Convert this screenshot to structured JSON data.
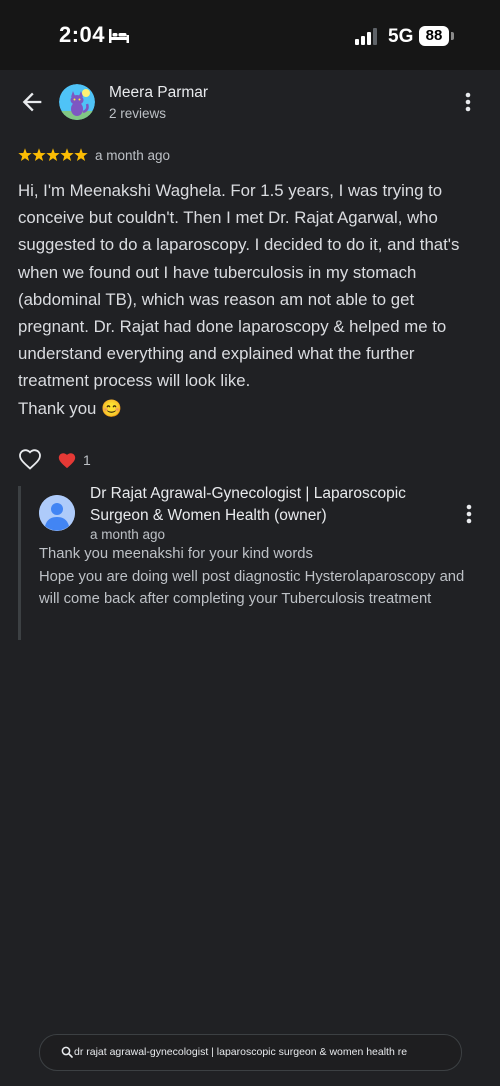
{
  "status_bar": {
    "time": "2:04",
    "network": "5G",
    "battery": "88",
    "icons": [
      "sleep-focus-icon",
      "signal-icon",
      "battery-icon"
    ]
  },
  "header": {
    "reviewer_name": "Meera Parmar",
    "review_count": "2 reviews",
    "icons": [
      "back-arrow-icon",
      "avatar-cat-illustration",
      "more-vert-icon"
    ]
  },
  "review": {
    "stars": 5,
    "max_stars": 5,
    "star_color": "#fbbc04",
    "time": "a month ago",
    "text": "Hi, I'm Meenakshi Waghela. For 1.5 years, I was trying to conceive but couldn't. Then I met Dr. Rajat Agarwal, who suggested to do a laparoscopy. I decided to do it, and that's when we found out I have tuberculosis in my stomach (abdominal TB), which was reason am not able to get pregnant. Dr. Rajat had done laparoscopy & helped me to understand everything and explained what the further treatment process will look like.\nThank you 😊",
    "reaction_count": "1",
    "icons": [
      "heart-outline-icon",
      "heart-reaction-icon"
    ]
  },
  "owner_reply": {
    "name": "Dr Rajat Agrawal-Gynecologist | Laparoscopic Surgeon & Women Health (owner)",
    "time": "a month ago",
    "text": "Thank you meenakshi for your kind words\nHope you are doing well post diagnostic Hysterolaparoscopy and will come back after completing your Tuberculosis treatment",
    "icons": [
      "default-avatar-icon",
      "more-vert-icon"
    ]
  },
  "search": {
    "query": "dr rajat agrawal-gynecologist | laparoscopic surgeon & women health re",
    "icon": "search-icon"
  },
  "colors": {
    "background": "#202124",
    "status_bar": "#161616",
    "text_primary": "#e8eaed",
    "text_secondary": "#bdc1c6",
    "star": "#fbbc04",
    "heart": "#e53935",
    "avatar_blue": "#4285f4"
  }
}
